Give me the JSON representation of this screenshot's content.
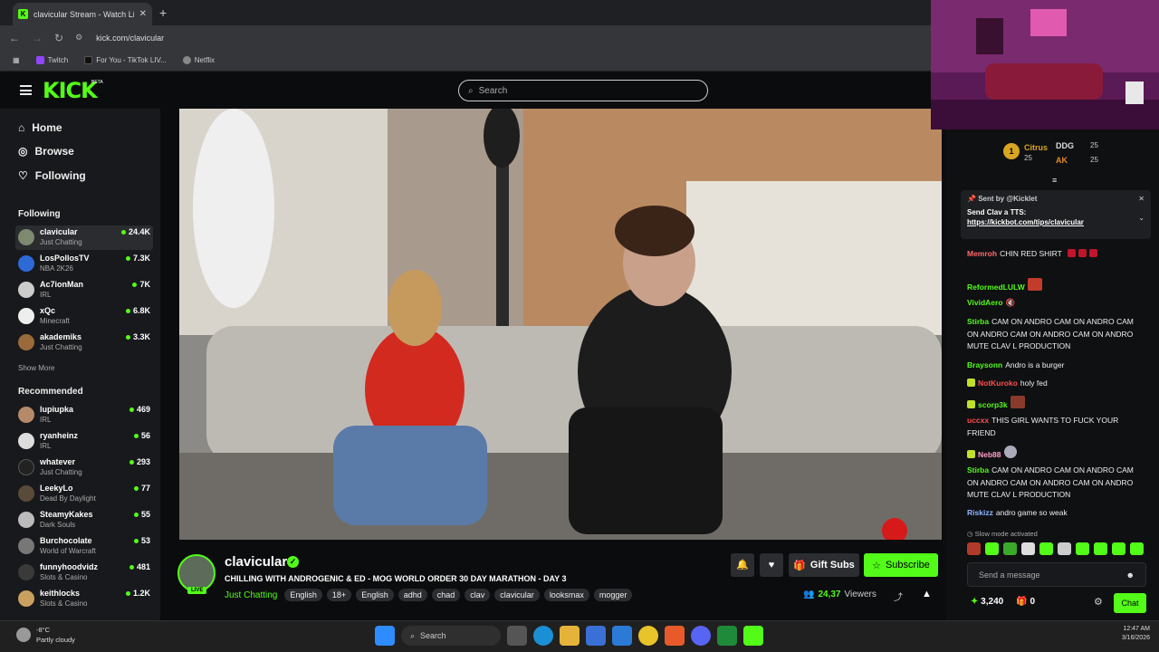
{
  "browser": {
    "tab_title": "clavicular Stream - Watch Live o",
    "tab_close": "✕",
    "new_tab": "+",
    "url": "kick.com/clavicular",
    "bookmarks": [
      "Twitch",
      "For You - TikTok LIV...",
      "Netflix"
    ]
  },
  "header": {
    "logo": "KICK",
    "logo_badge": "BETA",
    "search_placeholder": "Search"
  },
  "sidebar": {
    "nav": [
      "Home",
      "Browse",
      "Following"
    ],
    "following_header": "Following",
    "following": [
      {
        "name": "clavicular",
        "category": "Just Chatting",
        "viewers": "24.4K"
      },
      {
        "name": "LosPollosTV",
        "category": "NBA 2K26",
        "viewers": "7.3K"
      },
      {
        "name": "Ac7ionMan",
        "category": "IRL",
        "viewers": "7K"
      },
      {
        "name": "xQc",
        "category": "Minecraft",
        "viewers": "6.8K"
      },
      {
        "name": "akademiks",
        "category": "Just Chatting",
        "viewers": "3.3K"
      }
    ],
    "show_more": "Show More",
    "recommended_header": "Recommended",
    "recommended": [
      {
        "name": "lupiupka",
        "category": "IRL",
        "viewers": "469"
      },
      {
        "name": "ryanheinz",
        "category": "IRL",
        "viewers": "56"
      },
      {
        "name": "whatever",
        "category": "Just Chatting",
        "viewers": "293"
      },
      {
        "name": "LeekyLo",
        "category": "Dead By Daylight",
        "viewers": "77"
      },
      {
        "name": "SteamyKakes",
        "category": "Dark Souls",
        "viewers": "55"
      },
      {
        "name": "Burchocolate",
        "category": "World of Warcraft",
        "viewers": "53"
      },
      {
        "name": "funnyhoodvidz",
        "category": "Slots & Casino",
        "viewers": "481"
      },
      {
        "name": "keithlocks",
        "category": "Slots & Casino",
        "viewers": "1.2K"
      }
    ]
  },
  "stream": {
    "streamer": "clavicular",
    "live": "LIVE",
    "title": "CHILLING WITH ANDROGENIC & ED - MOG WORLD ORDER 30 DAY MARATHON - DAY 3",
    "category": "Just Chatting",
    "tags": [
      "English",
      "18+",
      "English",
      "adhd",
      "chad",
      "clav",
      "clavicular",
      "looksmax",
      "mogger"
    ],
    "gift_subs": "Gift Subs",
    "subscribe": "Subscribe",
    "viewers": "24,37",
    "viewers_label": "Viewers"
  },
  "chat": {
    "leaderboard": [
      {
        "rank": "1",
        "name": "Citrus",
        "amount": "25"
      },
      {
        "name": "DDG",
        "amount": "25"
      },
      {
        "name": "AK",
        "amount": "25"
      }
    ],
    "pinned": {
      "sent_by": "Sent by",
      "sender": "@Kicklet",
      "line1": "Send Clav a TTS:",
      "link": "https://kickbot.com/tips/clavicular"
    },
    "messages": [
      {
        "user": "Memroh",
        "color": "#ff6b6b",
        "text": "CHIN RED SHIRT"
      },
      {
        "user": "ReformedLULW",
        "color": "#53fc18",
        "text": ""
      },
      {
        "user": "VividAero",
        "color": "#53fc18",
        "text": ""
      },
      {
        "user": "Stirba",
        "color": "#53fc18",
        "text": "CAM ON ANDRO CAM ON ANDRO CAM ON ANDRO CAM ON ANDRO CAM ON ANDRO MUTE CLAV L PRODUCTION"
      },
      {
        "user": "Braysonn",
        "color": "#53fc18",
        "text": "Andro is a burger"
      },
      {
        "user": "NotKuroko",
        "color": "#ff4d4d",
        "text": "holy fed"
      },
      {
        "user": "scorp3k",
        "color": "#53fc18",
        "text": ""
      },
      {
        "user": "uccxx",
        "color": "#ff4d4d",
        "text": "THIS GIRL WANTS TO FUCK YOUR FRIEND"
      },
      {
        "user": "Neb88",
        "color": "#ff9ecb",
        "text": ""
      },
      {
        "user": "Stirba",
        "color": "#53fc18",
        "text": "CAM ON ANDRO CAM ON ANDRO CAM ON ANDRO CAM ON ANDRO CAM ON ANDRO MUTE CLAV L PRODUCTION"
      },
      {
        "user": "Riskizz",
        "color": "#8fb4ff",
        "text": "andro game so weak"
      }
    ],
    "slow_mode": "Slow mode activated",
    "send_placeholder": "Send a message",
    "points": "3,240",
    "gifts": "0",
    "chat_button": "Chat"
  },
  "taskbar": {
    "temp": "-8°C",
    "weather": "Partly cloudy",
    "search": "Search",
    "time": "12:47 AM",
    "date": "3/16/2026"
  }
}
